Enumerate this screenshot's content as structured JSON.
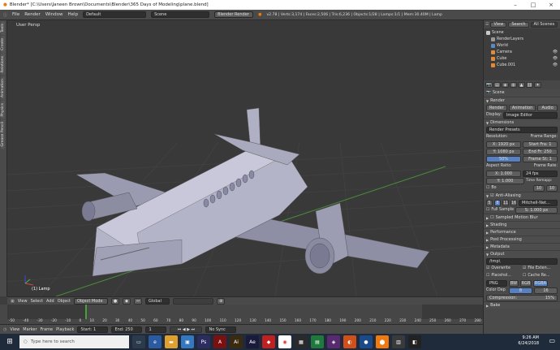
{
  "titlebar": {
    "title": "Blender* [C:\\Users\\Janeen Brown\\Documents\\Blender\\365 Days of Modeling\\plane.blend]"
  },
  "menubar": {
    "items": [
      "File",
      "Render",
      "Window",
      "Help"
    ],
    "layout": "Default",
    "scene": "Scene",
    "engine": "Blender Render",
    "stats": "v2.78 | Verts:3,174 | Faces:2,506 | Tris:6,236 | Objects:1/28 | Lamps:1/1 | Mem:30.40M | Lamp"
  },
  "left_tabs": [
    "Tools",
    "Create",
    "Relations",
    "Animation",
    "Physics",
    "Grease Pencil"
  ],
  "viewport": {
    "label": "User Persp",
    "object_label": "(1) Lamp"
  },
  "viewport_header": {
    "view": "View",
    "select": "Select",
    "add": "Add",
    "object": "Object",
    "mode": "Object Mode",
    "pivot": "Global"
  },
  "timeline": {
    "ticks": [
      "-50",
      "-40",
      "-30",
      "-20",
      "-10",
      "0",
      "10",
      "20",
      "30",
      "40",
      "50",
      "60",
      "70",
      "80",
      "90",
      "100",
      "110",
      "120",
      "130",
      "140",
      "150",
      "160",
      "170",
      "180",
      "190",
      "200",
      "210",
      "220",
      "230",
      "240",
      "250",
      "260",
      "270",
      "280"
    ],
    "header": {
      "view": "View",
      "marker": "Marker",
      "frame": "Frame",
      "playback": "Playback",
      "start_label": "Start:",
      "start": "1",
      "end_label": "End:",
      "end": "250",
      "current": "1",
      "sync": "No Sync"
    }
  },
  "outliner": {
    "tabs": [
      "View",
      "Search",
      "All Scenes"
    ],
    "items": [
      {
        "label": "Scene",
        "color": "#c8c8c8"
      },
      {
        "label": "RenderLayers",
        "color": "#9a9a9a"
      },
      {
        "label": "World",
        "color": "#5a8ac0"
      },
      {
        "label": "Camera",
        "color": "#e08a3a"
      },
      {
        "label": "Cube",
        "color": "#e08a3a"
      },
      {
        "label": "Cube.001",
        "color": "#e08a3a"
      }
    ]
  },
  "properties": {
    "scene": "Scene",
    "render_section": "Render",
    "render_btn": "Render",
    "anim_btn": "Animation",
    "audio_btn": "Audio",
    "display_label": "Display:",
    "display_value": "Image Editor",
    "dimensions_section": "Dimensions",
    "presets": "Render Presets",
    "resolution_label": "Resolution:",
    "frame_range_label": "Frame Range:",
    "res_x": "X: 1920 px",
    "res_y": "Y: 1080 px",
    "res_pct": "50%",
    "start_fr": "Start Fra: 1",
    "end_fr": "End Fr: 250",
    "frame_step": "Frame St: 1",
    "aspect_label": "Aspect Ratio:",
    "frame_rate_label": "Frame Rate:",
    "asp_x": "X: 1.000",
    "asp_y": "Y: 1.000",
    "fps": "24 fps",
    "time_remap_label": "Time Remapp:",
    "bo_label": "Bo",
    "remap_old": "10",
    "remap_new": "10",
    "aa_section": "Anti-Aliasing",
    "aa_samples": [
      "5",
      "8",
      "11",
      "16"
    ],
    "aa_filter": "Mitchell-Net...",
    "full_sample": "Full Sample",
    "filter_size": "S: 1.000 px",
    "smb_section": "Sampled Motion Blur",
    "shading_section": "Shading",
    "performance_section": "Performance",
    "post_section": "Post Processing",
    "metadata_section": "Metadata",
    "output_section": "Output",
    "output_path": "/tmp\\",
    "overwrite": "Overwrite",
    "file_ext": "File Exten...",
    "placeholders": "Placehol...",
    "cache_res": "Cache Re...",
    "format": "PNG",
    "bw": "BW",
    "rgb": "RGB",
    "rgba": "RGBA",
    "color_depth_label": "Color Dep",
    "depth_8": "8",
    "depth_16": "16",
    "compression": "Compression:",
    "compression_val": "15%",
    "bake_section": "Bake"
  },
  "taskbar": {
    "search_placeholder": "Type here to search",
    "time": "9:26 AM",
    "date": "6/24/2018"
  },
  "colors": {
    "accent": "#5680c2",
    "selected_orange": "#e08a3a",
    "plane": "#b4b4c8"
  }
}
